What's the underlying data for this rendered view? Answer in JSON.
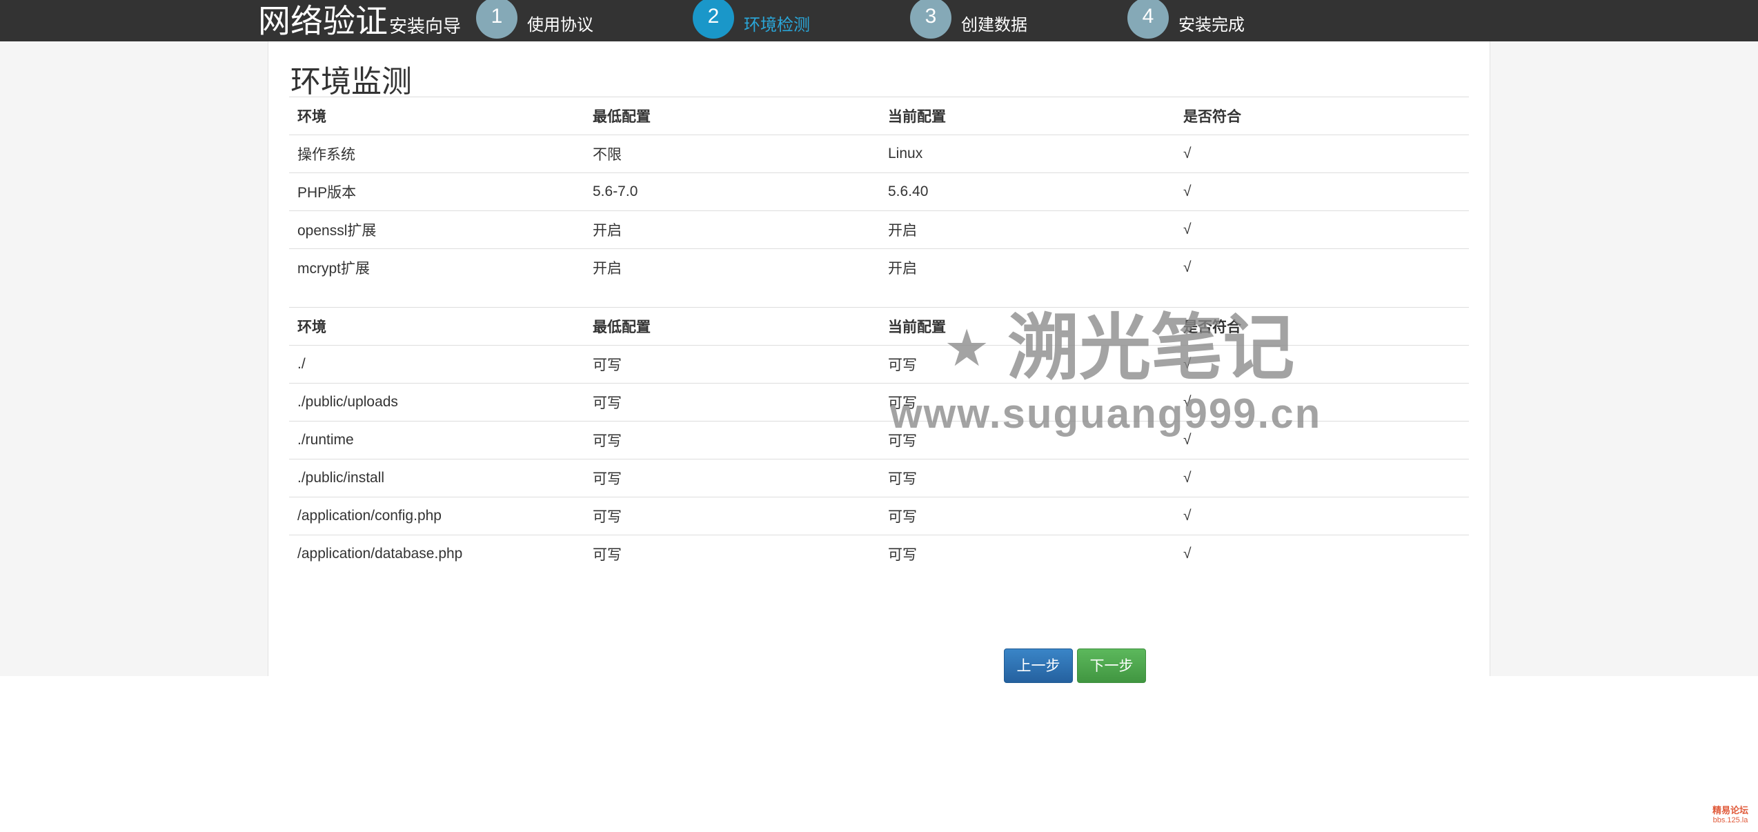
{
  "header": {
    "brand_main": "网络验证",
    "brand_sub": "安装向导",
    "steps": [
      {
        "number": "1",
        "label": "使用协议",
        "active": false
      },
      {
        "number": "2",
        "label": "环境检测",
        "active": true
      },
      {
        "number": "3",
        "label": "创建数据",
        "active": false
      },
      {
        "number": "4",
        "label": "安装完成",
        "active": false
      }
    ]
  },
  "main": {
    "title": "环境监测",
    "table1": {
      "headers": [
        "环境",
        "最低配置",
        "当前配置",
        "是否符合"
      ],
      "rows": [
        [
          "操作系统",
          "不限",
          "Linux",
          "√"
        ],
        [
          "PHP版本",
          "5.6-7.0",
          "5.6.40",
          "√"
        ],
        [
          "openssl扩展",
          "开启",
          "开启",
          "√"
        ],
        [
          "mcrypt扩展",
          "开启",
          "开启",
          "√"
        ]
      ]
    },
    "table2": {
      "headers": [
        "环境",
        "最低配置",
        "当前配置",
        "是否符合"
      ],
      "rows": [
        [
          "./",
          "可写",
          "可写",
          "√"
        ],
        [
          "./public/uploads",
          "可写",
          "可写",
          "√"
        ],
        [
          "./runtime",
          "可写",
          "可写",
          "√"
        ],
        [
          "./public/install",
          "可写",
          "可写",
          "√"
        ],
        [
          "/application/config.php",
          "可写",
          "可写",
          "√"
        ],
        [
          "/application/database.php",
          "可写",
          "可写",
          "√"
        ]
      ]
    },
    "buttons": {
      "prev": "上一步",
      "next": "下一步"
    }
  },
  "watermark": {
    "line1": "溯光笔记",
    "star": "★",
    "line2": "www.suguang999.cn"
  },
  "corner_mark": {
    "line1": "精易论坛",
    "line2": "bbs.125.la"
  },
  "colors": {
    "topbar": "#333333",
    "step_inactive": "#85a9b7",
    "step_active": "#1a97c9",
    "button_prev": "#2f74b5",
    "button_next": "#4eaa4e"
  }
}
